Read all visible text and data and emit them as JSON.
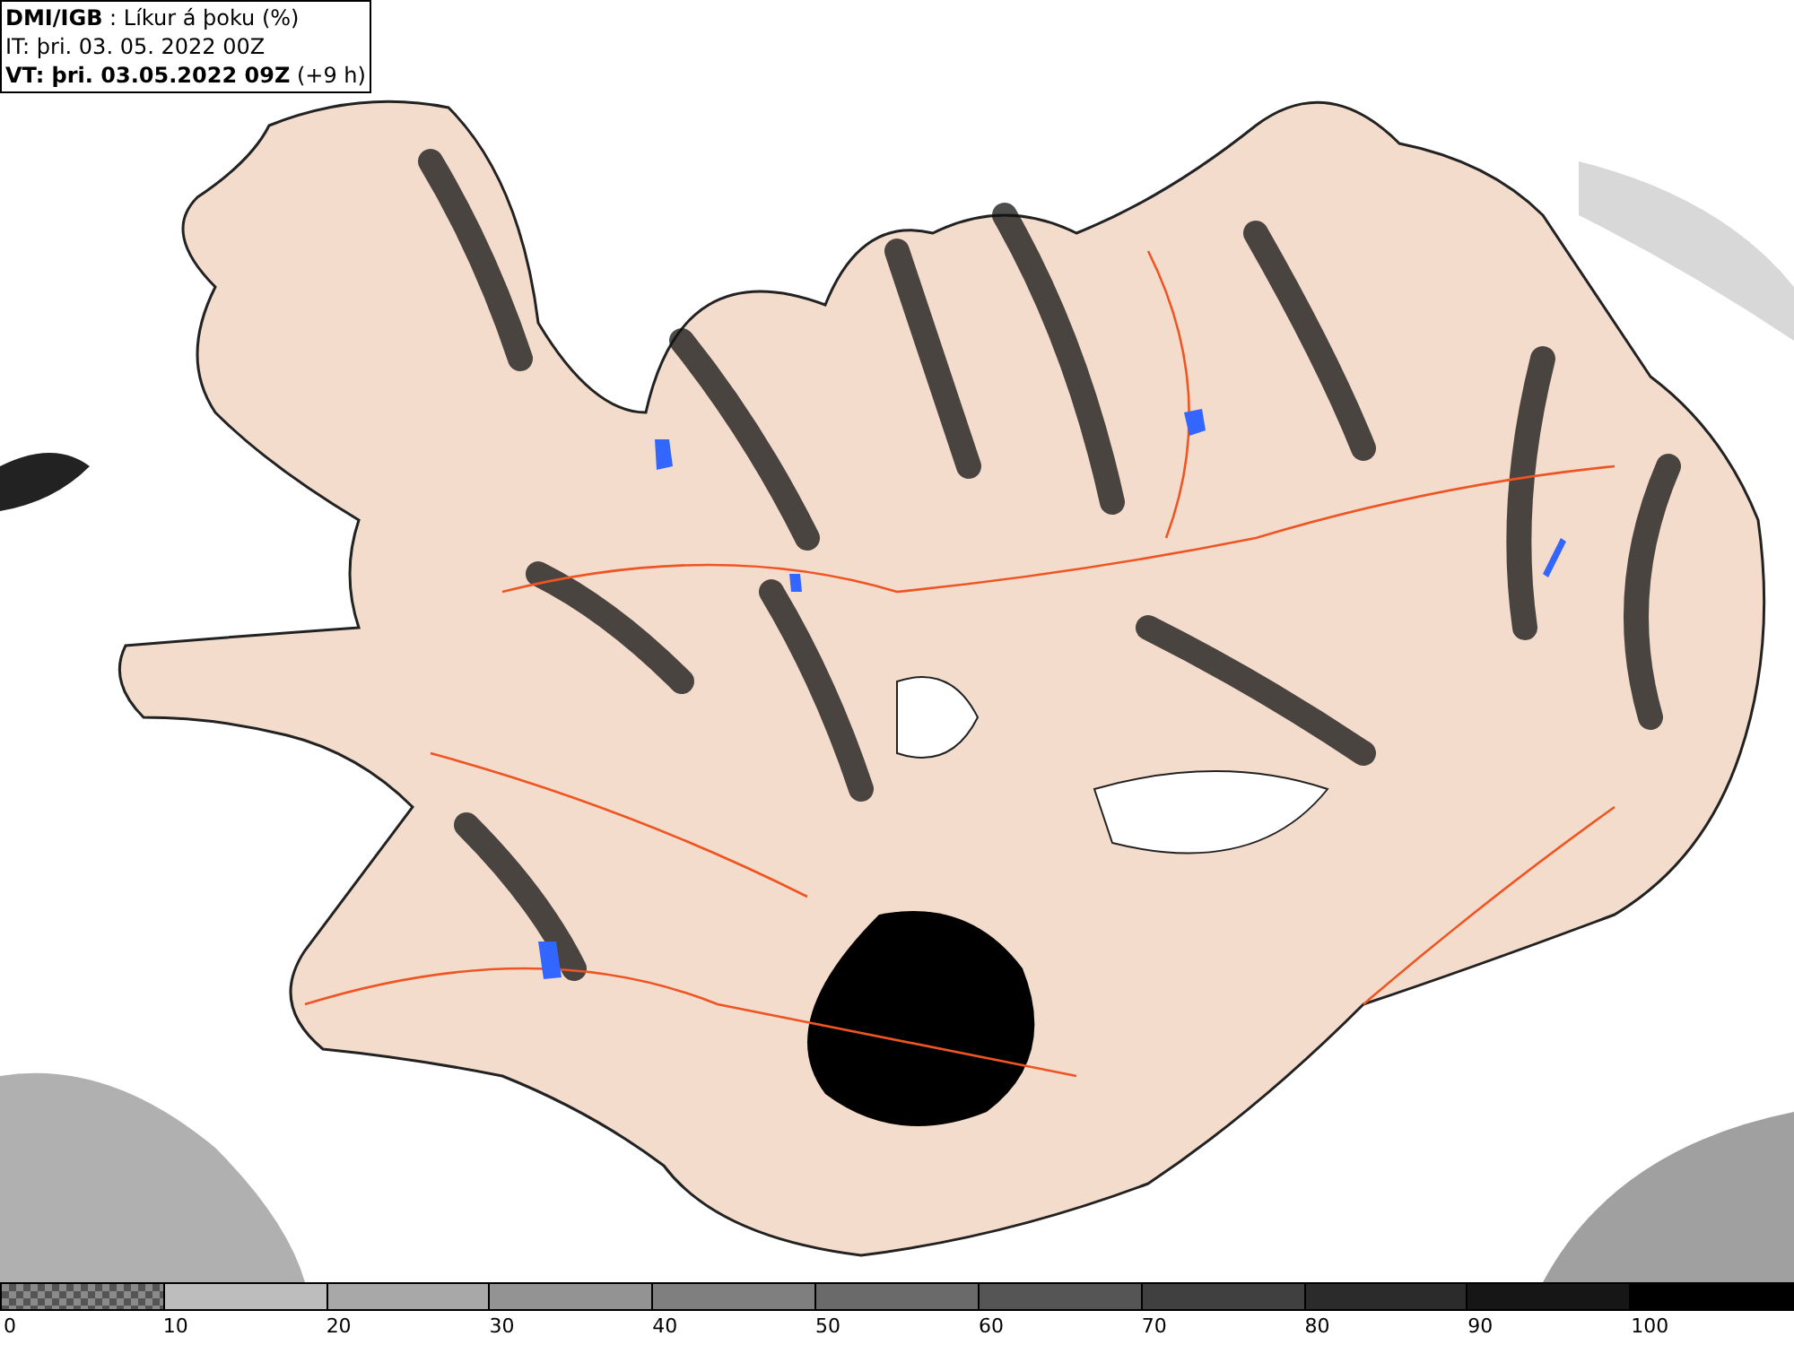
{
  "legend": {
    "lines": [
      "**DMI/IGB** : Líkur á þoku (%)",
      "IT: þri. 03. 05. 2022 00Z",
      "**VT: þri. 03.05.2022 09Z** (+9 h)"
    ]
  },
  "colorbar": {
    "segments": [
      {
        "kind": "checker",
        "color": "#8a8a8a"
      },
      {
        "kind": "solid",
        "color": "#bdbdbd"
      },
      {
        "kind": "solid",
        "color": "#a8a8a8"
      },
      {
        "kind": "solid",
        "color": "#939393"
      },
      {
        "kind": "solid",
        "color": "#7f7f7f"
      },
      {
        "kind": "solid",
        "color": "#6a6a6a"
      },
      {
        "kind": "solid",
        "color": "#555555"
      },
      {
        "kind": "solid",
        "color": "#404040"
      },
      {
        "kind": "solid",
        "color": "#2b2b2b"
      },
      {
        "kind": "solid",
        "color": "#161616"
      },
      {
        "kind": "solid",
        "color": "#000000"
      }
    ],
    "ticks": [
      "0",
      "10",
      "20",
      "30",
      "40",
      "50",
      "60",
      "70",
      "80",
      "90",
      "100"
    ]
  }
}
